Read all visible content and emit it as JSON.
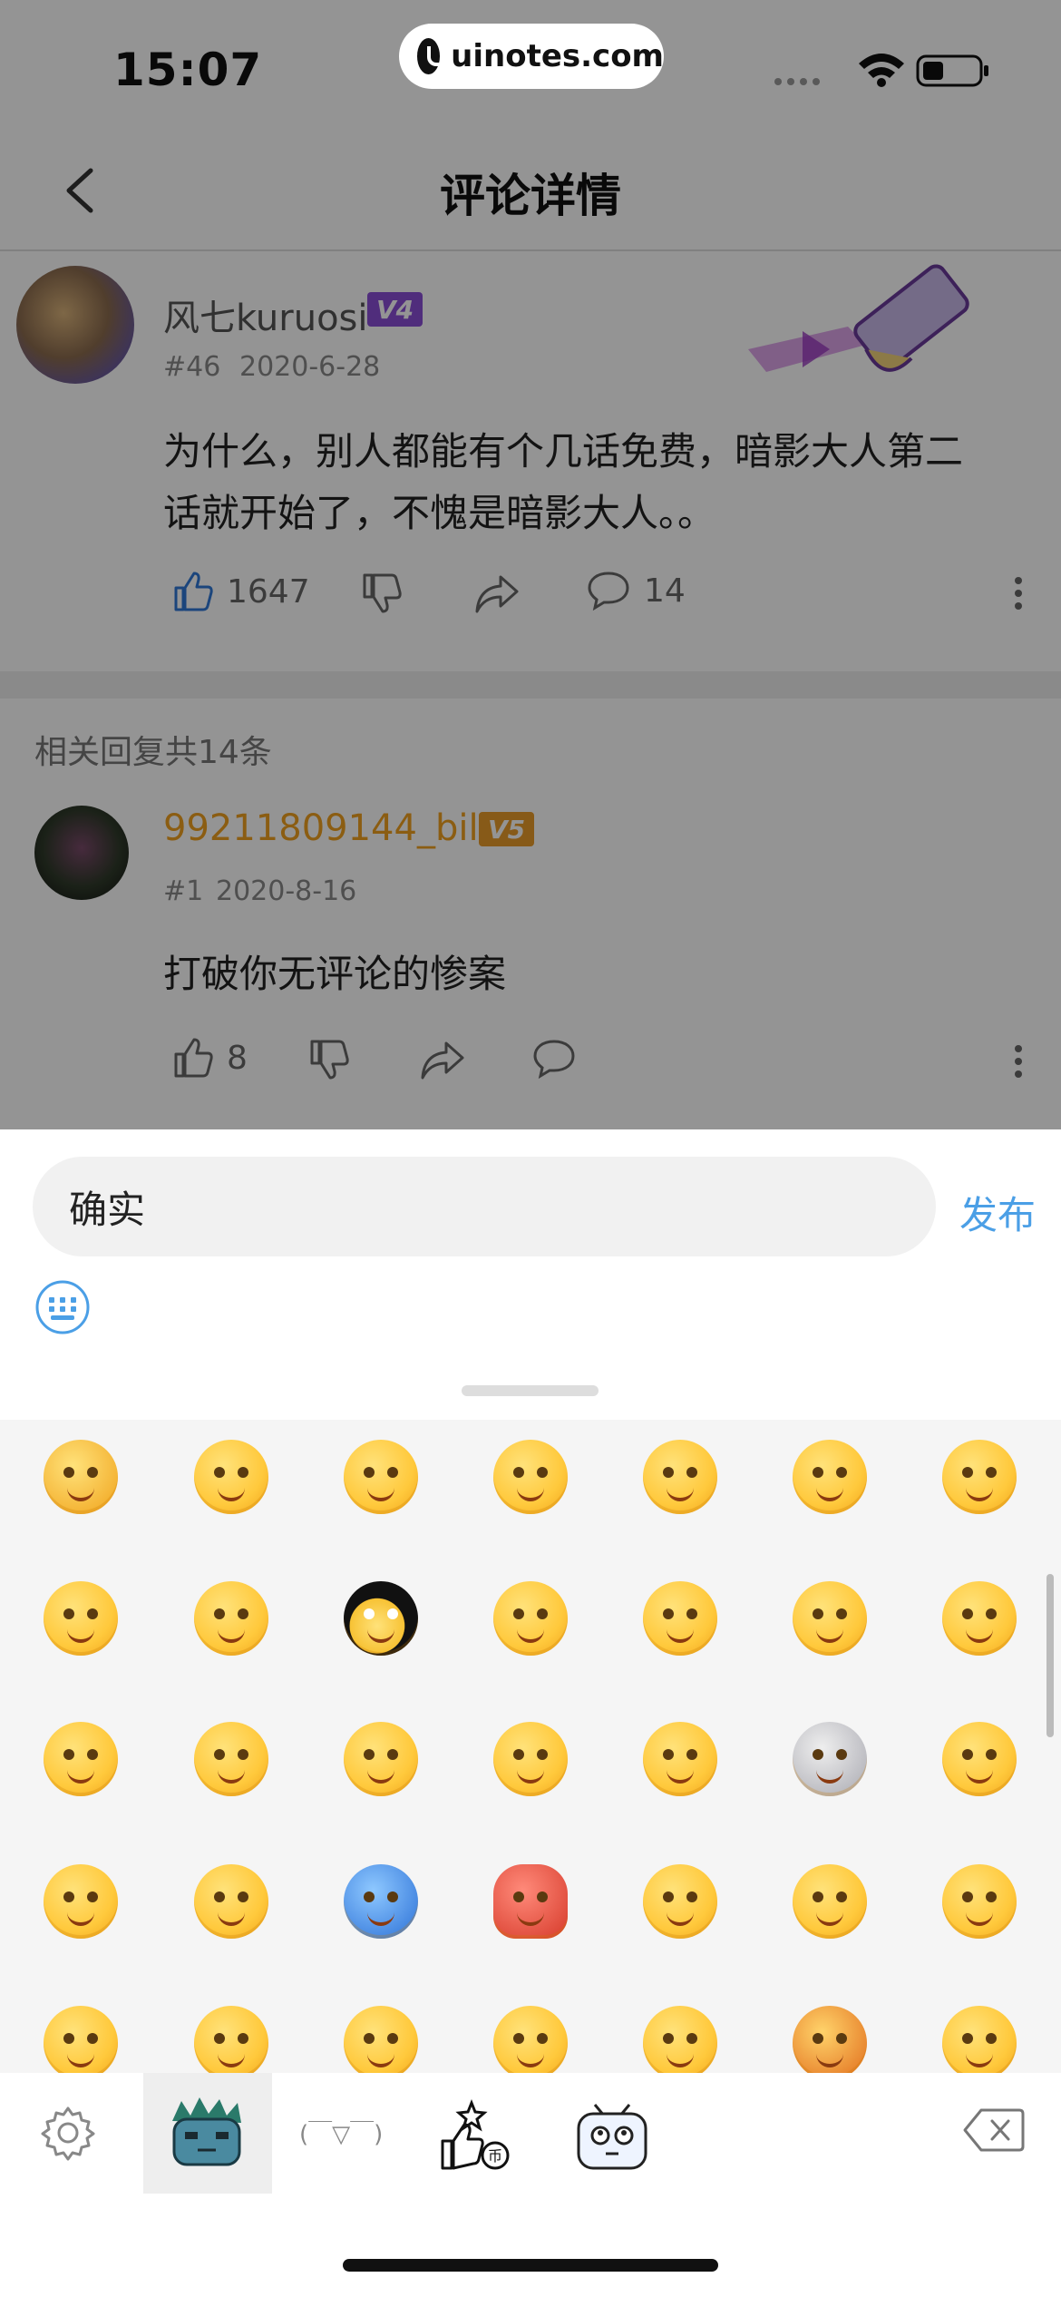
{
  "status_bar": {
    "time": "15:07",
    "url": "uinotes.com"
  },
  "header": {
    "title": "评论详情"
  },
  "main_comment": {
    "username": "风七kuruosi",
    "level": "V4",
    "floor": "#46",
    "date": "2020-6-28",
    "text_line1": "为什么，别人都能有个几话免费，暗影大人第二",
    "text_line2": "话就开始了，不愧是暗影大人。。",
    "likes": "1647",
    "comments": "14"
  },
  "replies": {
    "count_label": "相关回复共14条",
    "items": [
      {
        "username": "99211809144_bili",
        "level": "V5",
        "floor": "#1",
        "date": "2020-8-16",
        "text": "打破你无评论的惨案",
        "likes": "8"
      }
    ]
  },
  "composer": {
    "input_value": "确实",
    "publish_label": "发布"
  },
  "emoji_panel": {
    "kaomoji_label": "(￣▽￣)"
  },
  "colors": {
    "accent": "#4b9fe6",
    "like_blue": "#2f78d6",
    "vip_name": "#f0a020",
    "level_purple": "#8a4fd6",
    "level_orange": "#e89c2a"
  }
}
